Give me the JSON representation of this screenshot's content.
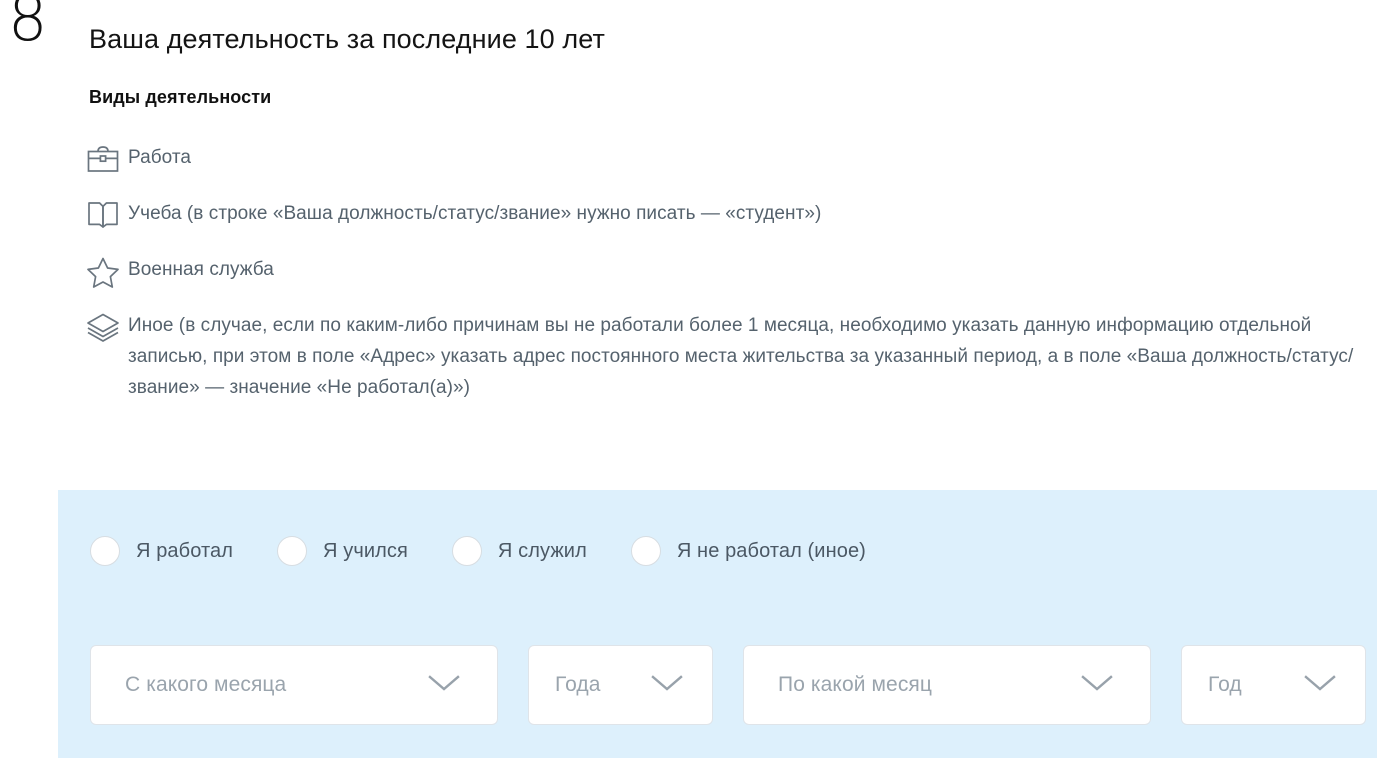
{
  "step": {
    "number": "8"
  },
  "header": {
    "title": "Ваша деятельность за последние 10 лет",
    "subtitle": "Виды деятельности"
  },
  "activities": [
    {
      "icon": "briefcase-icon",
      "text": "Работа"
    },
    {
      "icon": "book-icon",
      "text": "Учеба (в строке «Ваша должность/статус/звание» нужно писать — «студент»)"
    },
    {
      "icon": "star-icon",
      "text": "Военная служба"
    },
    {
      "icon": "layers-icon",
      "text": "Иное (в случае, если по каким-либо причинам вы не работали более 1 месяца, необходимо указать данную информацию отдельной записью, при этом в поле «Адрес» указать адрес постоянного места жительства за указанный период, а в поле «Ваша должность/статус/звание» — значение «Не работал(а)»)"
    }
  ],
  "form": {
    "radios": [
      {
        "label": "Я работал",
        "selected": false
      },
      {
        "label": "Я учился",
        "selected": false
      },
      {
        "label": "Я служил",
        "selected": false
      },
      {
        "label": "Я не работал (иное)",
        "selected": false
      }
    ],
    "selects": [
      {
        "name": "from-month",
        "placeholder": "С какого месяца",
        "value": "",
        "icon": "chevron-down-icon"
      },
      {
        "name": "from-year",
        "placeholder": "Года",
        "value": "",
        "icon": "chevron-down-icon"
      },
      {
        "name": "to-month",
        "placeholder": "По какой месяц",
        "value": "",
        "icon": "chevron-down-icon"
      },
      {
        "name": "to-year",
        "placeholder": "Год",
        "value": "",
        "icon": "chevron-down-icon"
      }
    ]
  },
  "colors": {
    "panel_background": "#ddf0fc",
    "page_background": "#ffffff",
    "body_text": "#55626d",
    "heading_text": "#141414",
    "placeholder_text": "#9aa4ad",
    "icon_stroke": "#6a757f",
    "field_border": "#dfe4e9"
  }
}
